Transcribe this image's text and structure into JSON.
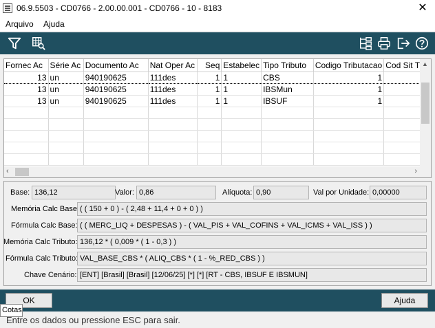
{
  "window": {
    "title": "06.9.5503 - CD0766 - 2.00.00.001 - CD0766 - 10 - 8183",
    "close_glyph": "✕"
  },
  "menu": [
    "Arquivo",
    "Ajuda"
  ],
  "toolbar": {
    "left_icons": [
      "filter-icon",
      "table-search-icon"
    ],
    "right_icons": [
      "structure-icon",
      "print-icon",
      "exit-icon",
      "help-icon"
    ],
    "icon_color": "#ffffff",
    "bar_color": "#1f4f60"
  },
  "grid": {
    "columns": [
      "Fornec Ac",
      "Série Ac",
      "Documento Ac",
      "Nat Oper Ac",
      "Seq",
      "Estabelec",
      "Tipo Tributo",
      "Codigo Tributacao",
      "Cod Sit Trib"
    ],
    "rows": [
      [
        "13",
        "un",
        "940190625",
        "111des",
        "1",
        "1",
        "CBS",
        "1",
        ""
      ],
      [
        "13",
        "un",
        "940190625",
        "111des",
        "1",
        "1",
        "IBSMun",
        "1",
        ""
      ],
      [
        "13",
        "un",
        "940190625",
        "111des",
        "1",
        "1",
        "IBSUF",
        "1",
        ""
      ]
    ]
  },
  "details": {
    "base_label": "Base:",
    "base_value": "136,12",
    "valor_label": "Valor:",
    "valor_value": "0,86",
    "aliquota_label": "Alíquota:",
    "aliquota_value": "0,90",
    "val_unidade_label": "Val por Unidade:",
    "val_unidade_value": "0,00000",
    "memoria_base_label": "Memória Calc Base:",
    "memoria_base_value": "( ( 150 + 0 ) - ( 2,48 + 11,4 + 0 + 0 ) )",
    "formula_base_label": "Fórmula Calc Base:",
    "formula_base_value": "( ( MERC_LIQ + DESPESAS ) - ( VAL_PIS + VAL_COFINS + VAL_ICMS + VAL_ISS ) )",
    "memoria_tributo_label": "Memória Calc Tributo:",
    "memoria_tributo_value": "136,12 * ( 0,009 * ( 1 - 0,3 ) )",
    "formula_tributo_label": "Fórmula Calc Tributo:",
    "formula_tributo_value": "VAL_BASE_CBS * ( ALIQ_CBS * ( 1 - %_RED_CBS ) )",
    "chave_label": "Chave Cenário:",
    "chave_value": "[ENT] [Brasil] [Brasil] [12/06/25] [*] [*] [RT - CBS, IBSUF E IBSMUN]"
  },
  "buttons": {
    "ok": "OK",
    "ajuda": "Ajuda"
  },
  "tooltip": "Cotas",
  "status": "Entre os dados ou pressione ESC para sair."
}
